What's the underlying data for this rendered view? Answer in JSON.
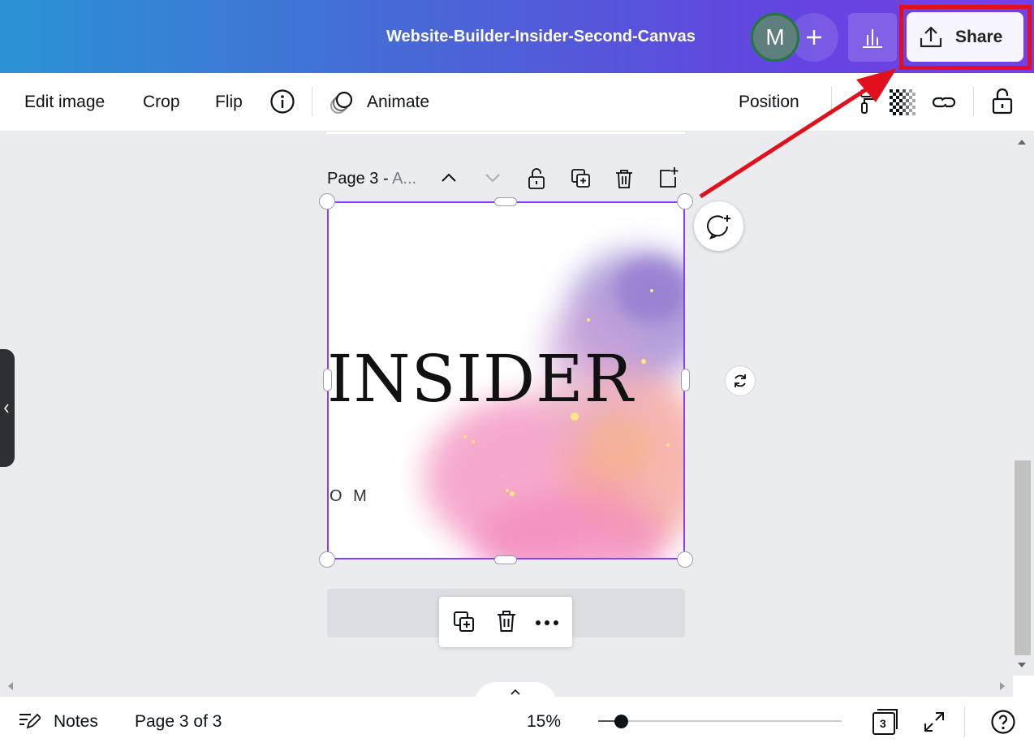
{
  "header": {
    "title": "Website-Builder-Insider-Second-Canvas",
    "avatar_initial": "M",
    "share_label": "Share"
  },
  "toolbar": {
    "edit_image": "Edit image",
    "crop": "Crop",
    "flip": "Flip",
    "animate": "Animate",
    "position": "Position"
  },
  "page": {
    "label_prefix": "Page 3 - ",
    "label_title": "A...",
    "insider_text": "INSIDER",
    "small_text": "O M"
  },
  "bottom": {
    "notes": "Notes",
    "page_counter": "Page 3 of 3",
    "zoom": "15%",
    "page_count_badge": "3"
  },
  "colors": {
    "accent": "#8b3dff",
    "highlight": "#e2101c",
    "header_start": "#2a93d5",
    "header_end": "#7440e6"
  }
}
